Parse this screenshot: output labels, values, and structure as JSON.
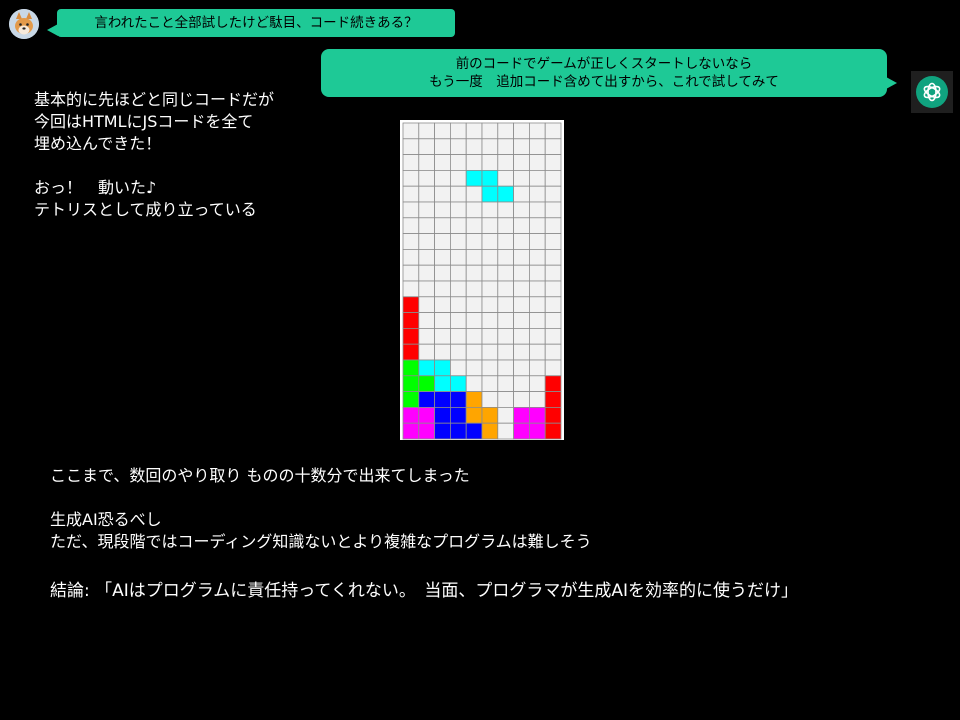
{
  "user_message": "言われたこと全部試したけど駄目、コード続きある？",
  "ai_message": {
    "line1": "前のコードでゲームが正しくスタートしないなら",
    "line2": "もう一度　追加コード含めて出すから、これで試してみて"
  },
  "notes": {
    "left": "基本的に先ほどと同じコードだが\n今回はHTMLにJSコードを全て\n埋め込んできた！\n\nおっ！　動いた♪\nテトリスとして成り立っている",
    "bottom": "ここまで、数回のやり取り ものの十数分で出来てしまった\n\n生成AI恐るべし\nただ、現段階ではコーディング知識ないとより複雑なプログラムは難しそう",
    "conclusion": "結論: 「AIはプログラムに責任持ってくれない。　当面、プログラマが生成AIを効率的に使うだけ」"
  },
  "icons": {
    "user_avatar": "shiba-dog-avatar-icon",
    "ai_avatar": "chatgpt-logo-icon"
  },
  "tetris": {
    "cols": 10,
    "rows": 20,
    "colors": {
      "R": "#ff0000",
      "G": "#00ff00",
      "C": "#00ffff",
      "B": "#0000ff",
      "O": "#ffa500",
      "M": "#ff00ff"
    },
    "grid": [
      "..........",
      "..........",
      "..........",
      "....CC....",
      ".....CC...",
      "..........",
      "..........",
      "..........",
      "..........",
      "..........",
      "..........",
      "R.........",
      "R.........",
      "R.........",
      "R.........",
      "GCC.......",
      "GGCC.....R",
      "GBBBO....R",
      "MMBBOO.MMR",
      "MMBBBO.MMR"
    ]
  }
}
